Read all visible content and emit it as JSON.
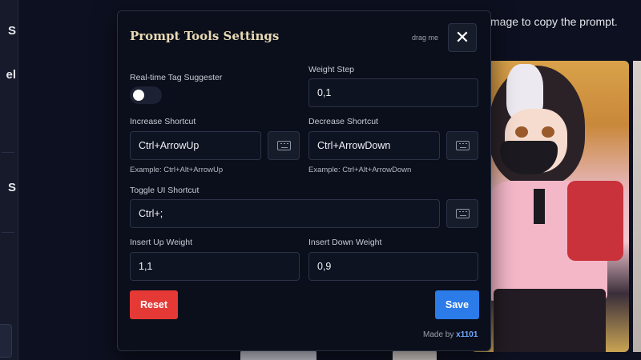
{
  "background": {
    "hint_text": "mage to copy the prompt.",
    "left_items": [
      "S",
      "el",
      "S"
    ]
  },
  "modal": {
    "title": "Prompt Tools Settings",
    "drag_label": "drag me",
    "close_icon": "close-icon",
    "realtime_tag_label": "Real-time Tag Suggester",
    "realtime_tag_enabled": false,
    "weight_step_label": "Weight Step",
    "weight_step_value": "0,1",
    "increase_label": "Increase Shortcut",
    "increase_value": "Ctrl+ArrowUp",
    "increase_example": "Example: Ctrl+Alt+ArrowUp",
    "decrease_label": "Decrease Shortcut",
    "decrease_value": "Ctrl+ArrowDown",
    "decrease_example": "Example: Ctrl+Alt+ArrowDown",
    "toggle_ui_label": "Toggle UI Shortcut",
    "toggle_ui_value": "Ctrl+;",
    "insert_up_label": "Insert Up Weight",
    "insert_up_value": "1,1",
    "insert_down_label": "Insert Down Weight",
    "insert_down_value": "0,9",
    "reset_label": "Reset",
    "save_label": "Save",
    "made_by_prefix": "Made by",
    "made_by_author": "x1101",
    "keyboard_icon": "keyboard-icon"
  },
  "colors": {
    "reset": "#e53935",
    "save": "#2b7be8",
    "title": "#e8d9b5",
    "author_link": "#6ea8ff"
  }
}
